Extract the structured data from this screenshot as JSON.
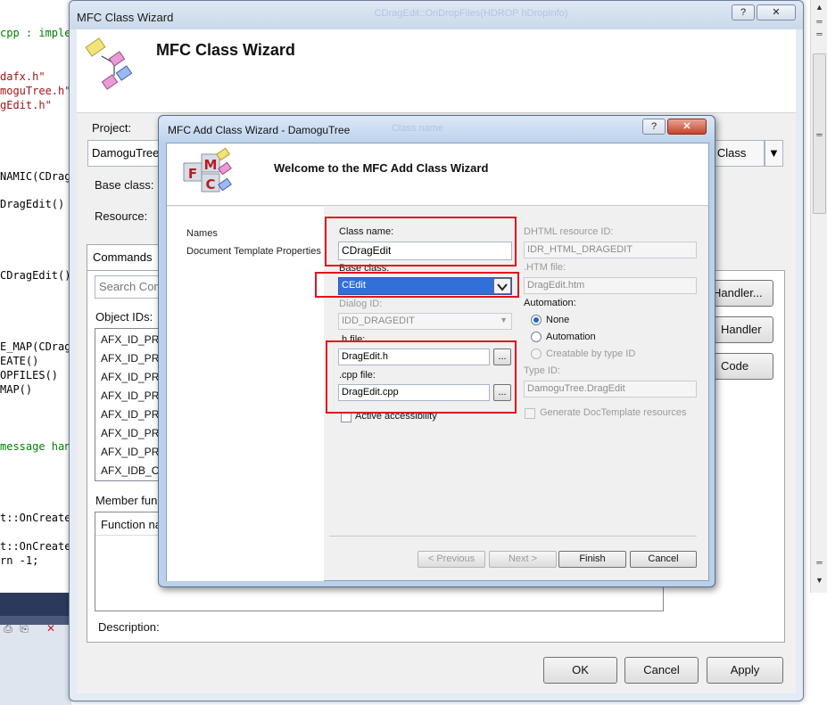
{
  "editor": {
    "lines": [
      {
        "text": "cpp : imple",
        "kind": "comment"
      },
      {
        "text": "dafx.h\"",
        "kind": "str"
      },
      {
        "text": "moguTree.h\"",
        "kind": "str"
      },
      {
        "text": "gEdit.h\"",
        "kind": "str"
      },
      {
        "text": "NAMIC(CDragE",
        "kind": "code"
      },
      {
        "text": "DragEdit()",
        "kind": "code"
      },
      {
        "text": "CDragEdit()",
        "kind": "code"
      },
      {
        "text": "E_MAP(CDragE",
        "kind": "code"
      },
      {
        "text": "EATE()",
        "kind": "code"
      },
      {
        "text": "OPFILES()",
        "kind": "code"
      },
      {
        "text": "MAP()",
        "kind": "code"
      },
      {
        "text": " message han",
        "kind": "comment"
      },
      {
        "text": "t::OnCreate",
        "kind": "code"
      },
      {
        "text": "t::OnCreate",
        "kind": "code"
      },
      {
        "text": "rn -1;",
        "kind": "code"
      }
    ]
  },
  "class_wizard": {
    "title": "MFC Class Wizard",
    "title_blur": "CDragEdit::OnDropFiles(HDROP hDropInfo)",
    "banner_title": "MFC Class Wizard",
    "project_label": "Project:",
    "project_value": "DamoguTree",
    "class_name_label": "Class name:",
    "add_class_button": "d Class",
    "base_class_label": "Base class:",
    "resource_label": "Resource:",
    "commands_tab": "Commands",
    "search_placeholder": "Search Com",
    "object_ids_label": "Object IDs:",
    "object_ids": [
      "AFX_ID_PRE",
      "AFX_ID_PRE",
      "AFX_ID_PRE",
      "AFX_ID_PRE",
      "AFX_ID_PRE",
      "AFX_ID_PRE",
      "AFX_ID_PRE",
      "AFX_IDB_CH"
    ],
    "member_functions_label": "Member fun",
    "function_name_header": "Function na",
    "add_handler_button": "Handler...",
    "delete_handler_button": "Handler",
    "edit_code_button": "Code",
    "description_label": "Description:",
    "ok_button": "OK",
    "cancel_button": "Cancel",
    "apply_button": "Apply"
  },
  "add_wizard": {
    "title": "MFC Add Class Wizard - DamoguTree",
    "title_blur": "Class name",
    "header_title": "Welcome to the MFC Add Class Wizard",
    "logo_letters": [
      "M",
      "F",
      "C"
    ],
    "nav_items": [
      "Names",
      "Document Template Properties"
    ],
    "class_name_label": "Class name:",
    "class_name_value": "CDragEdit",
    "base_class_label": "Base class:",
    "base_class_value": "CEdit",
    "dialog_id_label": "Dialog ID:",
    "dialog_id_value": "IDD_DRAGEDIT",
    "h_file_label": ".h file:",
    "h_file_value": "DragEdit.h",
    "cpp_file_label": ".cpp file:",
    "cpp_file_value": "DragEdit.cpp",
    "browse_label": "...",
    "active_accessibility": "Active accessibility",
    "dhtml_id_label": "DHTML resource ID:",
    "dhtml_id_value": "IDR_HTML_DRAGEDIT",
    "htm_file_label": ".HTM file:",
    "htm_file_value": "DragEdit.htm",
    "automation_label": "Automation:",
    "automation_options": [
      "None",
      "Automation",
      "Creatable by type ID"
    ],
    "type_id_label": "Type ID:",
    "type_id_value": "DamoguTree.DragEdit",
    "generate_doctemplate": "Generate DocTemplate resources",
    "previous_button": "< Previous",
    "next_button": "Next >",
    "finish_button": "Finish",
    "cancel_button": "Cancel",
    "help_button": "?",
    "close_button": "✕"
  },
  "colors": {
    "highlight_red": "#e0141c",
    "selection_blue": "#3070d8",
    "window_frame": "#b9d1ea"
  }
}
